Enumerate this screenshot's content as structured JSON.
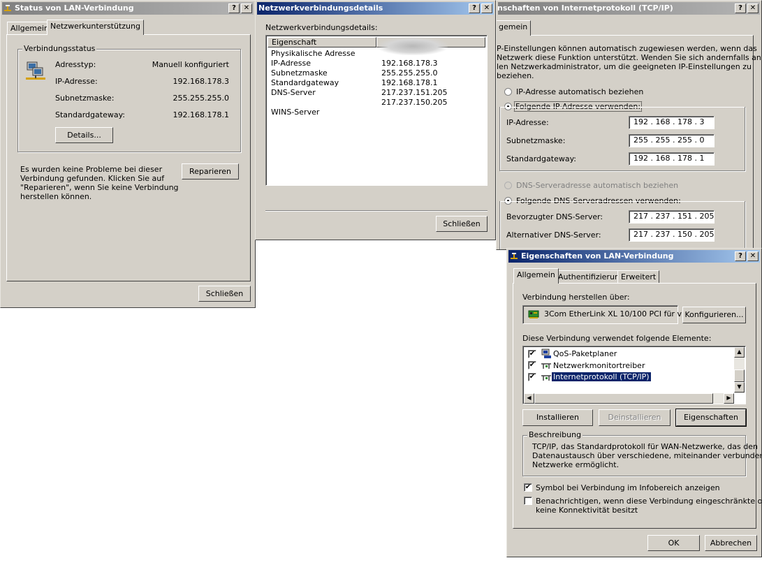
{
  "status_window": {
    "title": "Status von LAN-Verbindung",
    "help_btn": "?",
    "close_btn": "✕",
    "tabs": [
      "Allgemein",
      "Netzwerkunterstützung"
    ],
    "group_label": "Verbindungsstatus",
    "rows": [
      {
        "label": "Adresstyp:",
        "value": "Manuell konfiguriert"
      },
      {
        "label": "IP-Adresse:",
        "value": "192.168.178.3"
      },
      {
        "label": "Subnetzmaske:",
        "value": "255.255.255.0"
      },
      {
        "label": "Standardgateway:",
        "value": "192.168.178.1"
      }
    ],
    "details_button": "Details...",
    "message_lines": [
      "Es wurden keine Probleme bei dieser",
      "Verbindung gefunden. Klicken Sie auf",
      "\"Reparieren\", wenn Sie keine Verbindung",
      "herstellen können."
    ],
    "repair_button": "Reparieren",
    "close_button": "Schließen"
  },
  "details_window": {
    "title": "Netzwerkverbindungsdetails",
    "help_btn": "?",
    "close_btn": "✕",
    "label": "Netzwerkverbindungsdetails:",
    "col_header": "Eigenschaft",
    "rows": [
      {
        "name": "Physikalische Adresse",
        "value": ""
      },
      {
        "name": "IP-Adresse",
        "value": "192.168.178.3"
      },
      {
        "name": "Subnetzmaske",
        "value": "255.255.255.0"
      },
      {
        "name": "Standardgateway",
        "value": "192.168.178.1"
      },
      {
        "name": "DNS-Server",
        "value": "217.237.151.205"
      },
      {
        "name": "",
        "value": "217.237.150.205"
      },
      {
        "name": "WINS-Server",
        "value": ""
      }
    ],
    "close_button": "Schließen"
  },
  "tcpip_window": {
    "title": "nschaften von Internetprotokoll (TCP/IP)",
    "help_btn": "?",
    "close_btn": "✕",
    "tab": "gemein",
    "intro_lines": [
      "P-Einstellungen können automatisch zugewiesen werden, wenn das",
      "Netzwerk diese Funktion unterstützt. Wenden Sie sich andernfalls an",
      "len Netzwerkadministrator, um die geeigneten IP-Einstellungen zu",
      "beziehen."
    ],
    "radio_auto_ip": "IP-Adresse automatisch beziehen",
    "radio_manual_ip": "Folgende IP-Adresse verwenden:",
    "ip_label": "IP-Adresse:",
    "ip_value": "192 . 168 . 178 .  3",
    "mask_label": "Subnetzmaske:",
    "mask_value": "255 . 255 . 255 .  0",
    "gw_label": "Standardgateway:",
    "gw_value": "192 . 168 . 178 .  1",
    "radio_auto_dns": "DNS-Serveradresse automatisch beziehen",
    "radio_manual_dns": "Folgende DNS-Serveradressen verwenden:",
    "dns1_label": "Bevorzugter DNS-Server:",
    "dns1_value": "217 . 237 . 151 . 205",
    "dns2_label": "Alternativer DNS-Server:",
    "dns2_value": "217 . 237 . 150 . 205"
  },
  "lan_props_window": {
    "title": "Eigenschaften von LAN-Verbindung",
    "help_btn": "?",
    "close_btn": "✕",
    "tabs": [
      "Allgemein",
      "Authentifizierung",
      "Erweitert"
    ],
    "connect_using_label": "Verbindung herstellen über:",
    "adapter_name": "3Com EtherLink XL 10/100 PCI für v",
    "configure_button": "Konfigurieren...",
    "items_label": "Diese Verbindung verwendet folgende Elemente:",
    "items": [
      {
        "label": "QoS-Paketplaner",
        "checked": true
      },
      {
        "label": "Netzwerkmonitortreiber",
        "checked": true
      },
      {
        "label": "Internetprotokoll (TCP/IP)",
        "checked": true
      }
    ],
    "install_button": "Installieren",
    "uninstall_button": "Deinstallieren",
    "properties_button": "Eigenschaften",
    "description_label": "Beschreibung",
    "description_lines": [
      "TCP/IP, das Standardprotokoll für WAN-Netzwerke, das den",
      "Datenaustausch über verschiedene, miteinander verbundene",
      "Netzwerke ermöglicht."
    ],
    "checkbox_tray": "Symbol bei Verbindung im Infobereich anzeigen",
    "checkbox_notify_lines": [
      "Benachrichtigen, wenn diese Verbindung eingeschränkte oder",
      "keine Konnektivität besitzt"
    ],
    "ok_button": "OK",
    "cancel_button": "Abbrechen"
  }
}
